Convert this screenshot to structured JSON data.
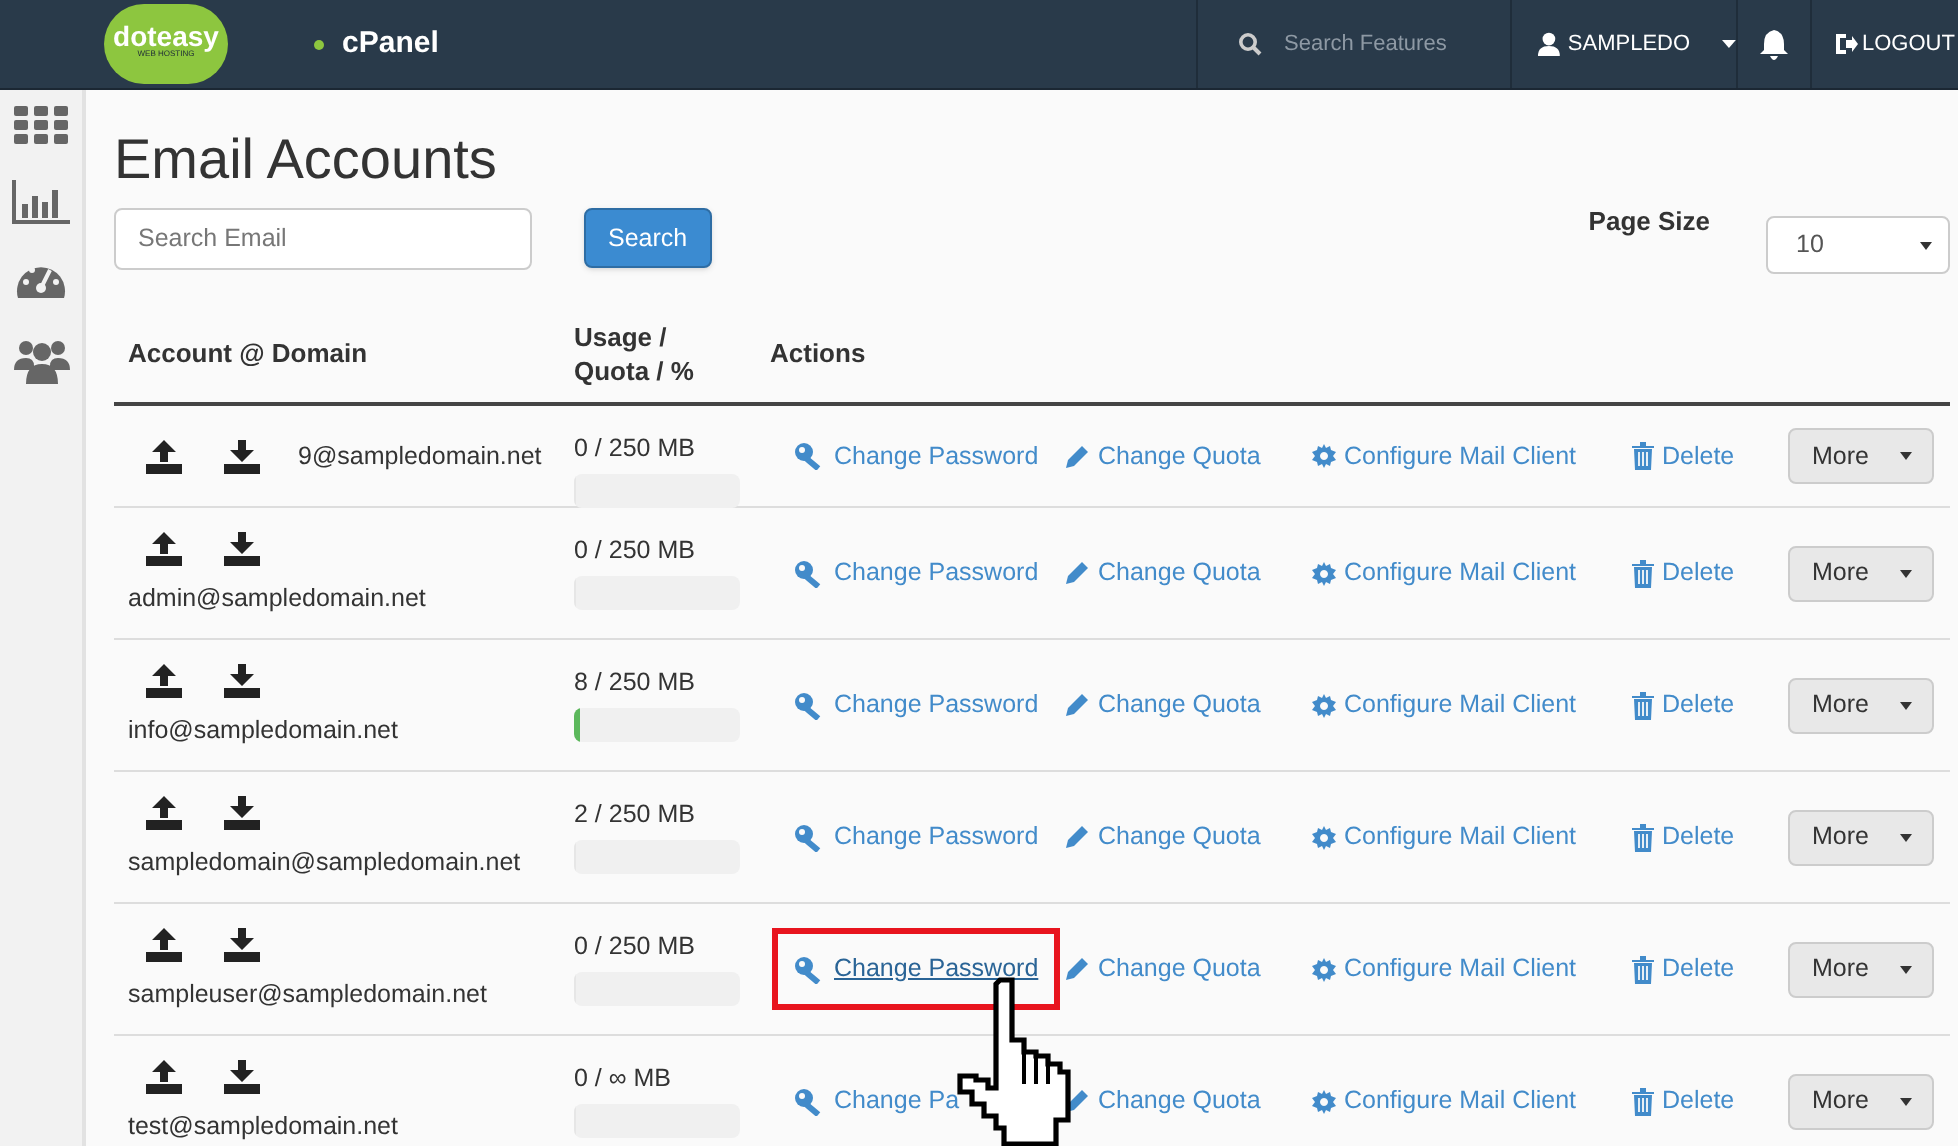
{
  "header": {
    "logo": {
      "word_1": "dot",
      "word_2": "easy",
      "tagline": "WEB HOSTING"
    },
    "product": "cPanel",
    "search": {
      "placeholder": "Search Features"
    },
    "user": "SAMPLEDO",
    "logout": "LOGOUT"
  },
  "page_title": "Email Accounts",
  "search": {
    "placeholder": "Search Email",
    "button": "Search"
  },
  "page_size": {
    "label": "Page Size",
    "value": "10"
  },
  "table": {
    "columns": [
      "Account @ Domain",
      "Usage / Quota / %",
      "Actions"
    ],
    "rows": [
      {
        "account": "9@sampledomain.net",
        "usage": "0 / 250 MB",
        "level": 0,
        "actions": [
          "Change Password",
          "Change Quota",
          "Configure Mail Client",
          "Delete"
        ],
        "more": "More",
        "highlighted": false,
        "inline": true
      },
      {
        "account": "admin@sampledomain.net",
        "usage": "0 / 250 MB",
        "level": 0,
        "actions": [
          "Change Password",
          "Change Quota",
          "Configure Mail Client",
          "Delete"
        ],
        "more": "More",
        "highlighted": false,
        "inline": false
      },
      {
        "account": "info@sampledomain.net",
        "usage": "8 / 250 MB",
        "level": 0.032,
        "actions": [
          "Change Password",
          "Change Quota",
          "Configure Mail Client",
          "Delete"
        ],
        "more": "More",
        "highlighted": false,
        "inline": false
      },
      {
        "account": "sampledomain@sampledomain.net",
        "usage": "2 / 250 MB",
        "level": 0,
        "actions": [
          "Change Password",
          "Change Quota",
          "Configure Mail Client",
          "Delete"
        ],
        "more": "More",
        "highlighted": false,
        "inline": false
      },
      {
        "account": "sampleuser@sampledomain.net",
        "usage": "0 / 250 MB",
        "level": 0,
        "actions": [
          "Change Password",
          "Change Quota",
          "Configure Mail Client",
          "Delete"
        ],
        "more": "More",
        "highlighted": true,
        "inline": false
      },
      {
        "account": "test@sampledomain.net",
        "usage": "0 / ∞ MB",
        "level": 0,
        "actions": [
          "Change Pa",
          "Change Quota",
          "Configure Mail Client",
          "Delete"
        ],
        "more": "More",
        "highlighted": false,
        "inline": false
      }
    ]
  }
}
